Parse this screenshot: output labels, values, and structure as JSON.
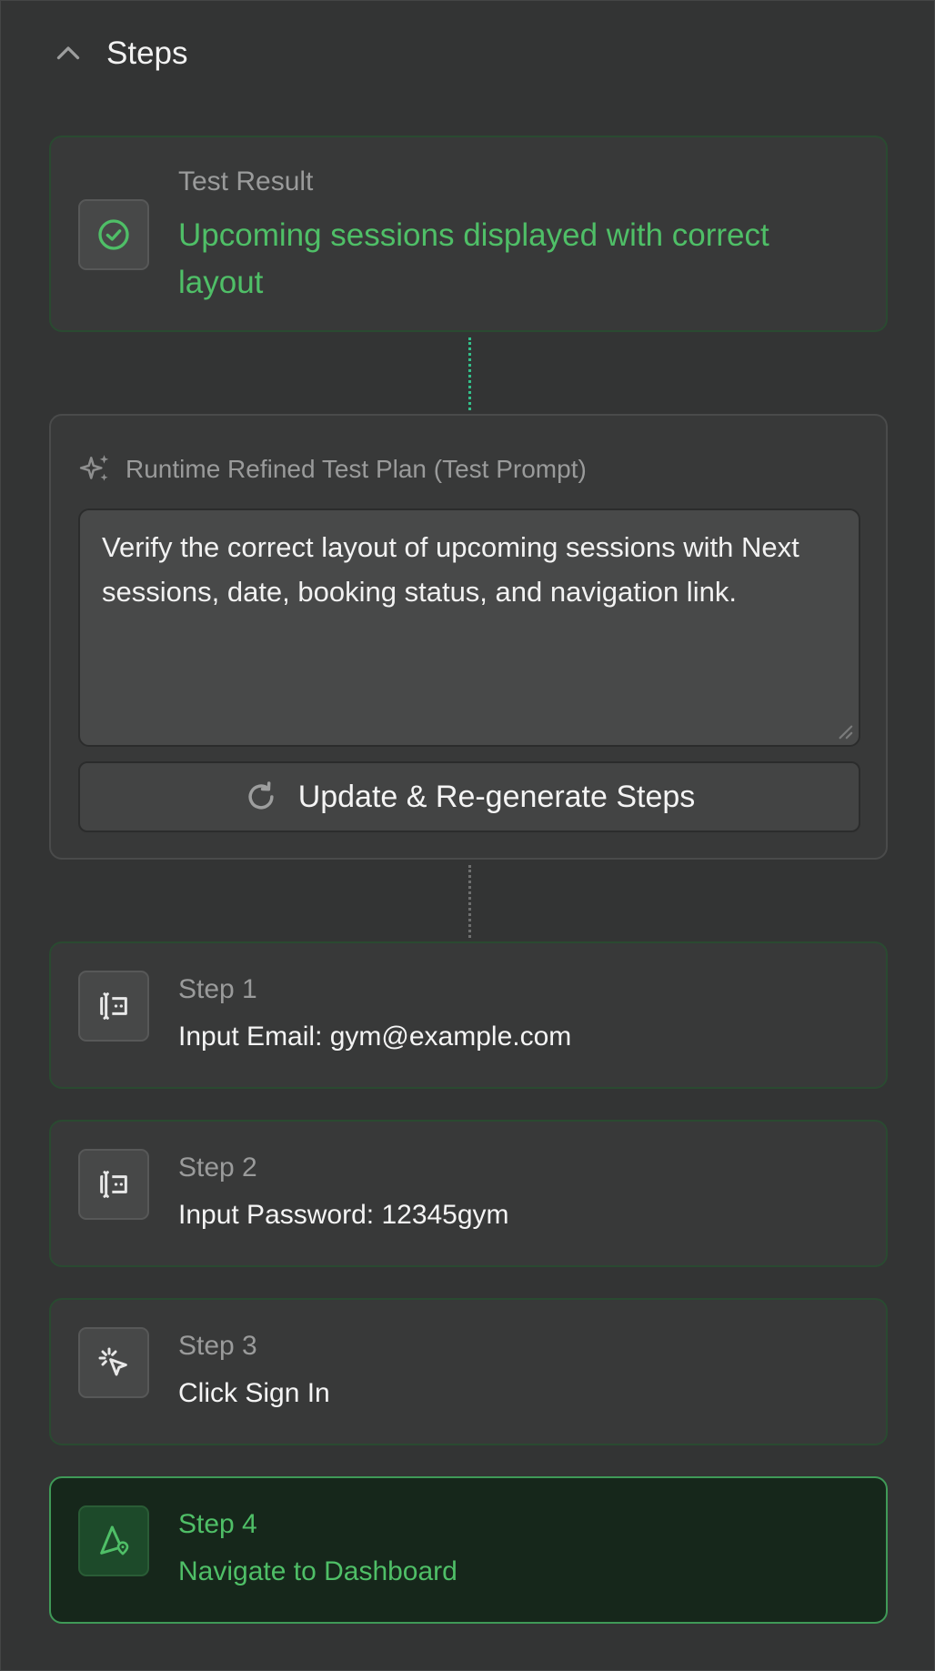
{
  "header": {
    "title": "Steps"
  },
  "result": {
    "label": "Test Result",
    "value": "Upcoming sessions displayed with correct layout"
  },
  "plan": {
    "title": "Runtime Refined Test Plan (Test Prompt)",
    "prompt": "Verify the correct layout of upcoming sessions with Next sessions, date, booking status, and navigation link.",
    "regenerate_label": "Update & Re-generate Steps"
  },
  "steps": [
    {
      "label": "Step 1",
      "action": "Input Email: gym@example.com",
      "icon": "text-input-icon"
    },
    {
      "label": "Step 2",
      "action": "Input Password: 12345gym",
      "icon": "text-input-icon"
    },
    {
      "label": "Step 3",
      "action": "Click Sign In",
      "icon": "click-pointer-icon"
    },
    {
      "label": "Step 4",
      "action": "Navigate to Dashboard",
      "icon": "navigate-location-icon"
    }
  ],
  "colors": {
    "background": "#333434",
    "accent_green": "#4fbf67",
    "active_step_bg": "#16271b",
    "connector_green": "#33c08a"
  }
}
